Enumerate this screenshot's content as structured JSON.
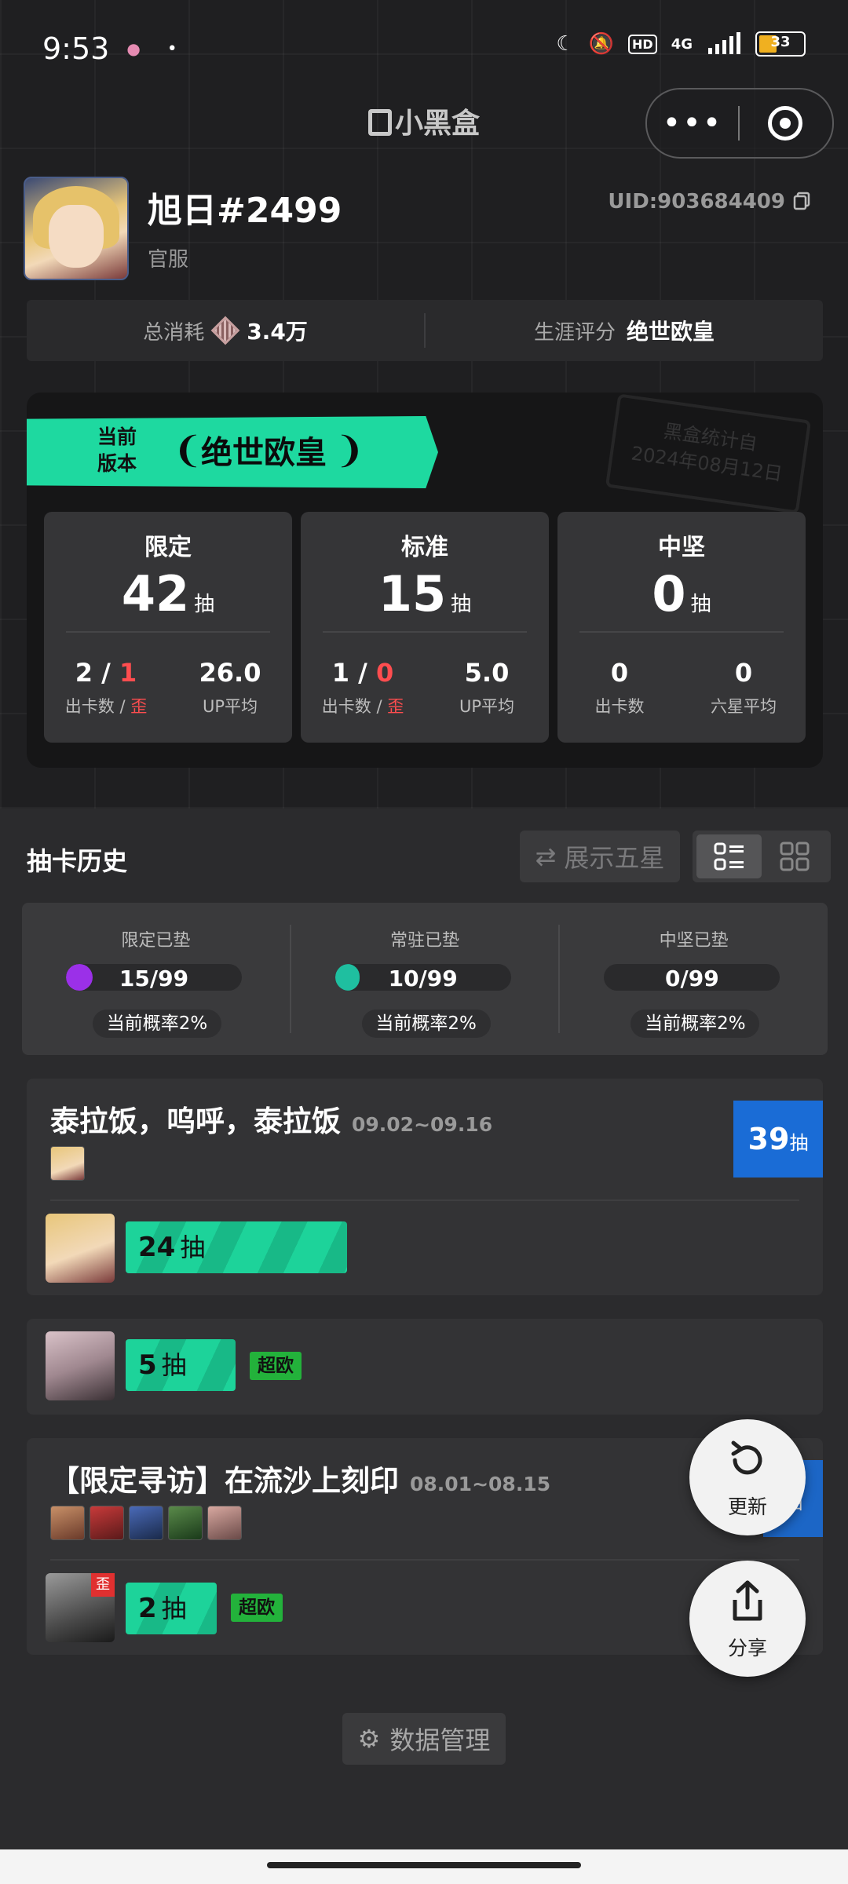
{
  "status_bar": {
    "time": "9:53",
    "hd": "HD",
    "network": "4G",
    "battery": "33"
  },
  "header": {
    "brand": "小黑盒"
  },
  "profile": {
    "username": "旭日#2499",
    "server": "官服",
    "uid": "UID:903684409",
    "total_spend_label": "总消耗",
    "total_spend_value": "3.4万",
    "career_label": "生涯评分",
    "career_value": "绝世欧皇"
  },
  "version_card": {
    "label_line1": "当前",
    "label_line2": "版本",
    "title": "绝世欧皇",
    "laurel_left": "❨",
    "laurel_right": "❩",
    "stamp_line1": "黑盒统计自",
    "stamp_line2": "2024年08月12日",
    "pools": [
      {
        "name": "限定",
        "count": "42",
        "unit": "抽",
        "stat1_num": "2",
        "stat1_sep": " / ",
        "stat1_red": "1",
        "stat1_label": "出卡数 / ",
        "stat1_label_red": "歪",
        "stat2_num": "26.0",
        "stat2_label": "UP平均"
      },
      {
        "name": "标准",
        "count": "15",
        "unit": "抽",
        "stat1_num": "1",
        "stat1_sep": " / ",
        "stat1_red": "0",
        "stat1_label": "出卡数 / ",
        "stat1_label_red": "歪",
        "stat2_num": "5.0",
        "stat2_label": "UP平均"
      },
      {
        "name": "中坚",
        "count": "0",
        "unit": "抽",
        "stat1_num": "0",
        "stat1_sep": "",
        "stat1_red": "",
        "stat1_label": "出卡数",
        "stat1_label_red": "",
        "stat2_num": "0",
        "stat2_label": "六星平均"
      }
    ]
  },
  "history": {
    "title": "抽卡历史",
    "show_five_star": "展示五星",
    "pity": [
      {
        "title": "限定已垫",
        "value": "15/99",
        "progress": 0.1515,
        "color": "#9b30e8",
        "rate": "当前概率2%"
      },
      {
        "title": "常驻已垫",
        "value": "10/99",
        "progress": 0.101,
        "color": "#1fbfa0",
        "rate": "当前概率2%"
      },
      {
        "title": "中坚已垫",
        "value": "0/99",
        "progress": 0,
        "color": "#888888",
        "rate": "当前概率2%"
      }
    ],
    "banners": [
      {
        "name": "泰拉饭，呜呼，泰拉饭",
        "dates": "09.02~09.16",
        "total_num": "39",
        "total_unit": "抽",
        "pulls": [
          {
            "count": "24",
            "unit": "抽",
            "tag": ""
          }
        ]
      },
      {
        "pulls": [
          {
            "count": "5",
            "unit": "抽",
            "tag": "超欧"
          }
        ]
      },
      {
        "name": "【限定寻访】在流沙上刻印",
        "dates": "08.01~08.15",
        "total_num": "",
        "total_unit": "抽",
        "pulls": [
          {
            "count": "2",
            "unit": "抽",
            "tag": "超欧",
            "badge": "歪"
          }
        ]
      }
    ]
  },
  "fab": {
    "refresh_label": "更新",
    "share_label": "分享"
  },
  "data_manage": "数据管理"
}
